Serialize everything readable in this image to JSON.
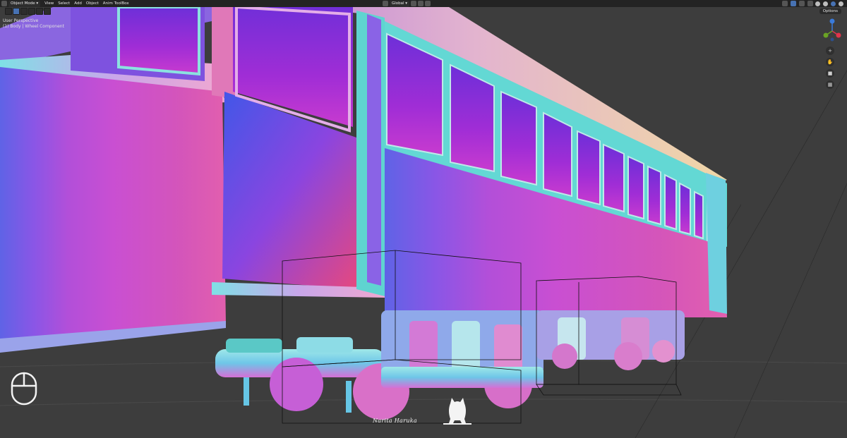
{
  "header": {
    "mode_label": "Object Mode",
    "menus": [
      "View",
      "Select",
      "Add",
      "Object",
      "Anim ToolBox"
    ],
    "orientation_label": "Global"
  },
  "options_label": "Options",
  "viewport": {
    "perspective_label": "User Perspective",
    "collection_label": "(1) Body | Wheel Component"
  },
  "signature": "Narita Haruka",
  "colors": {
    "header_bg": "#232323",
    "viewport_bg": "#3d3d3d",
    "accent": "#4772b3",
    "gizmo_x": "#e0344b",
    "gizmo_y": "#6aa324",
    "gizmo_z": "#3a7bdb"
  },
  "icons": [
    "editor-type-icon",
    "mouse-icon",
    "zoom-icon",
    "pan-icon",
    "camera-icon",
    "grid-icon",
    "navigation-gizmo",
    "cat-logo"
  ]
}
